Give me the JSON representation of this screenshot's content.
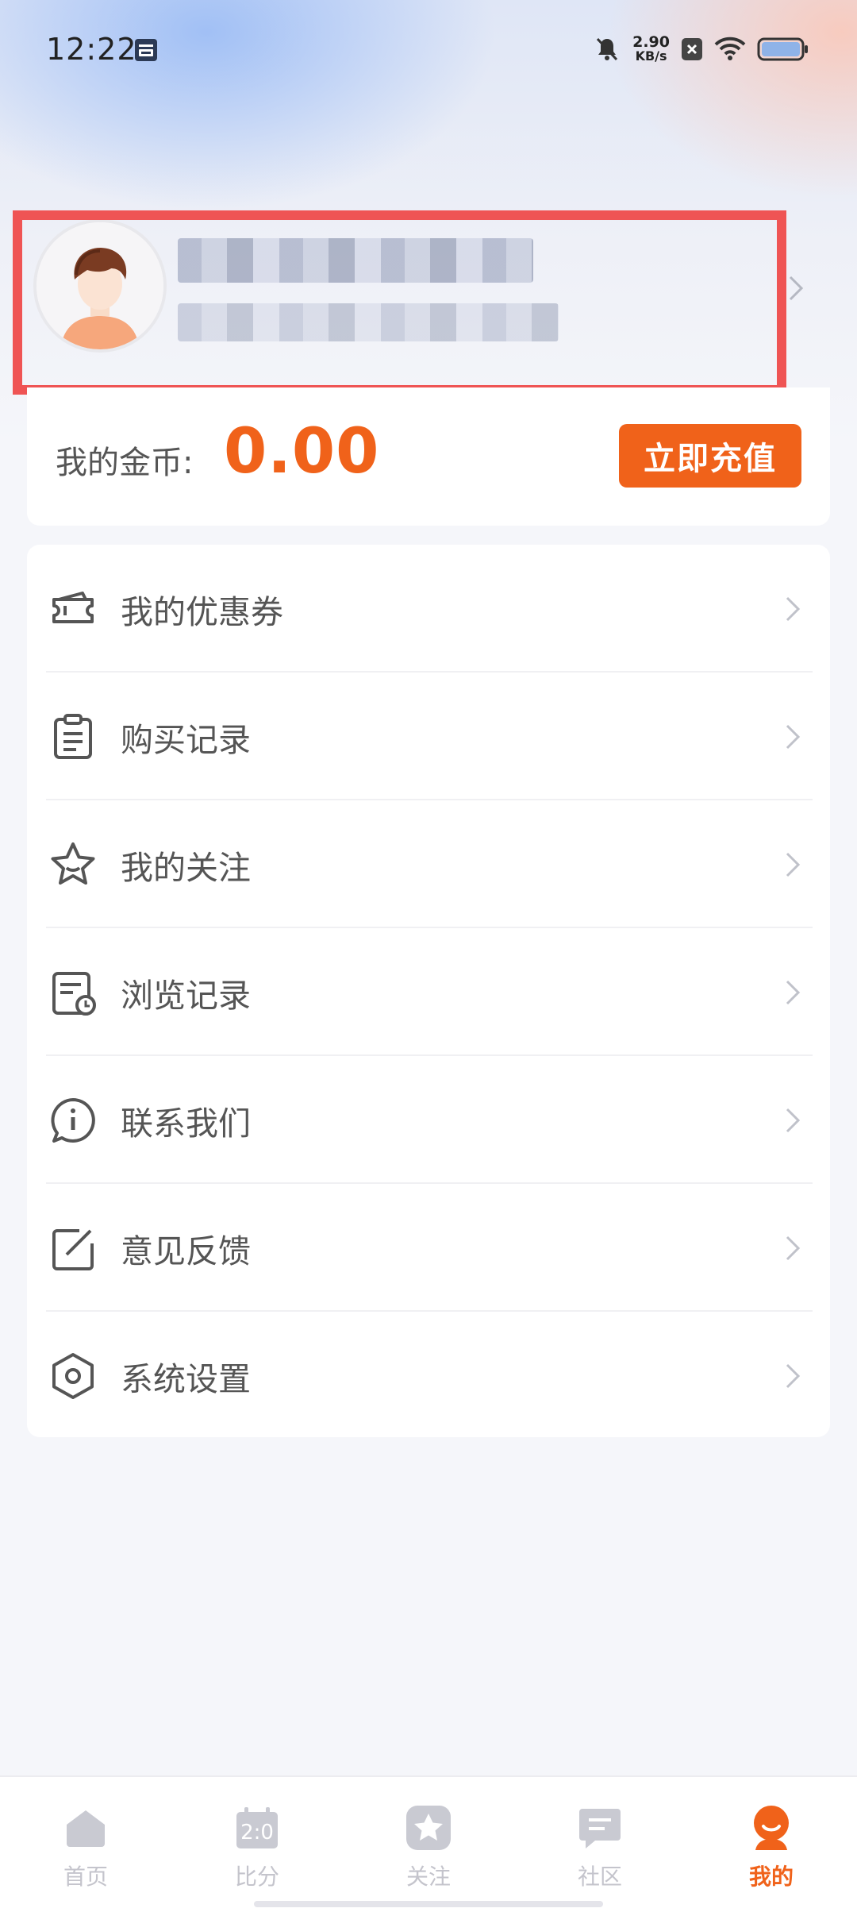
{
  "status_bar": {
    "time": "12:22",
    "net_speed_value": "2.90",
    "net_speed_unit": "KB/s",
    "icons": [
      "calendar-icon",
      "bell-muted-icon",
      "close-box-icon",
      "wifi-icon",
      "battery-icon"
    ]
  },
  "profile": {
    "avatar_icon": "user-avatar",
    "name": "",
    "subtitle": ""
  },
  "coins": {
    "label": "我的金币:",
    "value": "0.00",
    "recharge_label": "立即充值"
  },
  "menu": {
    "items": [
      {
        "label": "我的优惠券",
        "icon": "ticket-icon"
      },
      {
        "label": "购买记录",
        "icon": "clipboard-icon"
      },
      {
        "label": "我的关注",
        "icon": "star-icon"
      },
      {
        "label": "浏览记录",
        "icon": "history-icon"
      },
      {
        "label": "联系我们",
        "icon": "info-chat-icon"
      },
      {
        "label": "意见反馈",
        "icon": "edit-icon"
      },
      {
        "label": "系统设置",
        "icon": "settings-hex-icon"
      }
    ]
  },
  "bottom_nav": {
    "items": [
      {
        "label": "首页",
        "icon": "home-icon",
        "active": false
      },
      {
        "label": "比分",
        "icon": "score-icon",
        "icon_text": "2:0",
        "active": false
      },
      {
        "label": "关注",
        "icon": "star-badge-icon",
        "active": false
      },
      {
        "label": "社区",
        "icon": "chat-icon",
        "active": false
      },
      {
        "label": "我的",
        "icon": "profile-icon",
        "active": true
      }
    ]
  },
  "colors": {
    "accent": "#f0621a",
    "highlight_border": "#ef5454",
    "inactive_nav": "#c4c4cc"
  }
}
